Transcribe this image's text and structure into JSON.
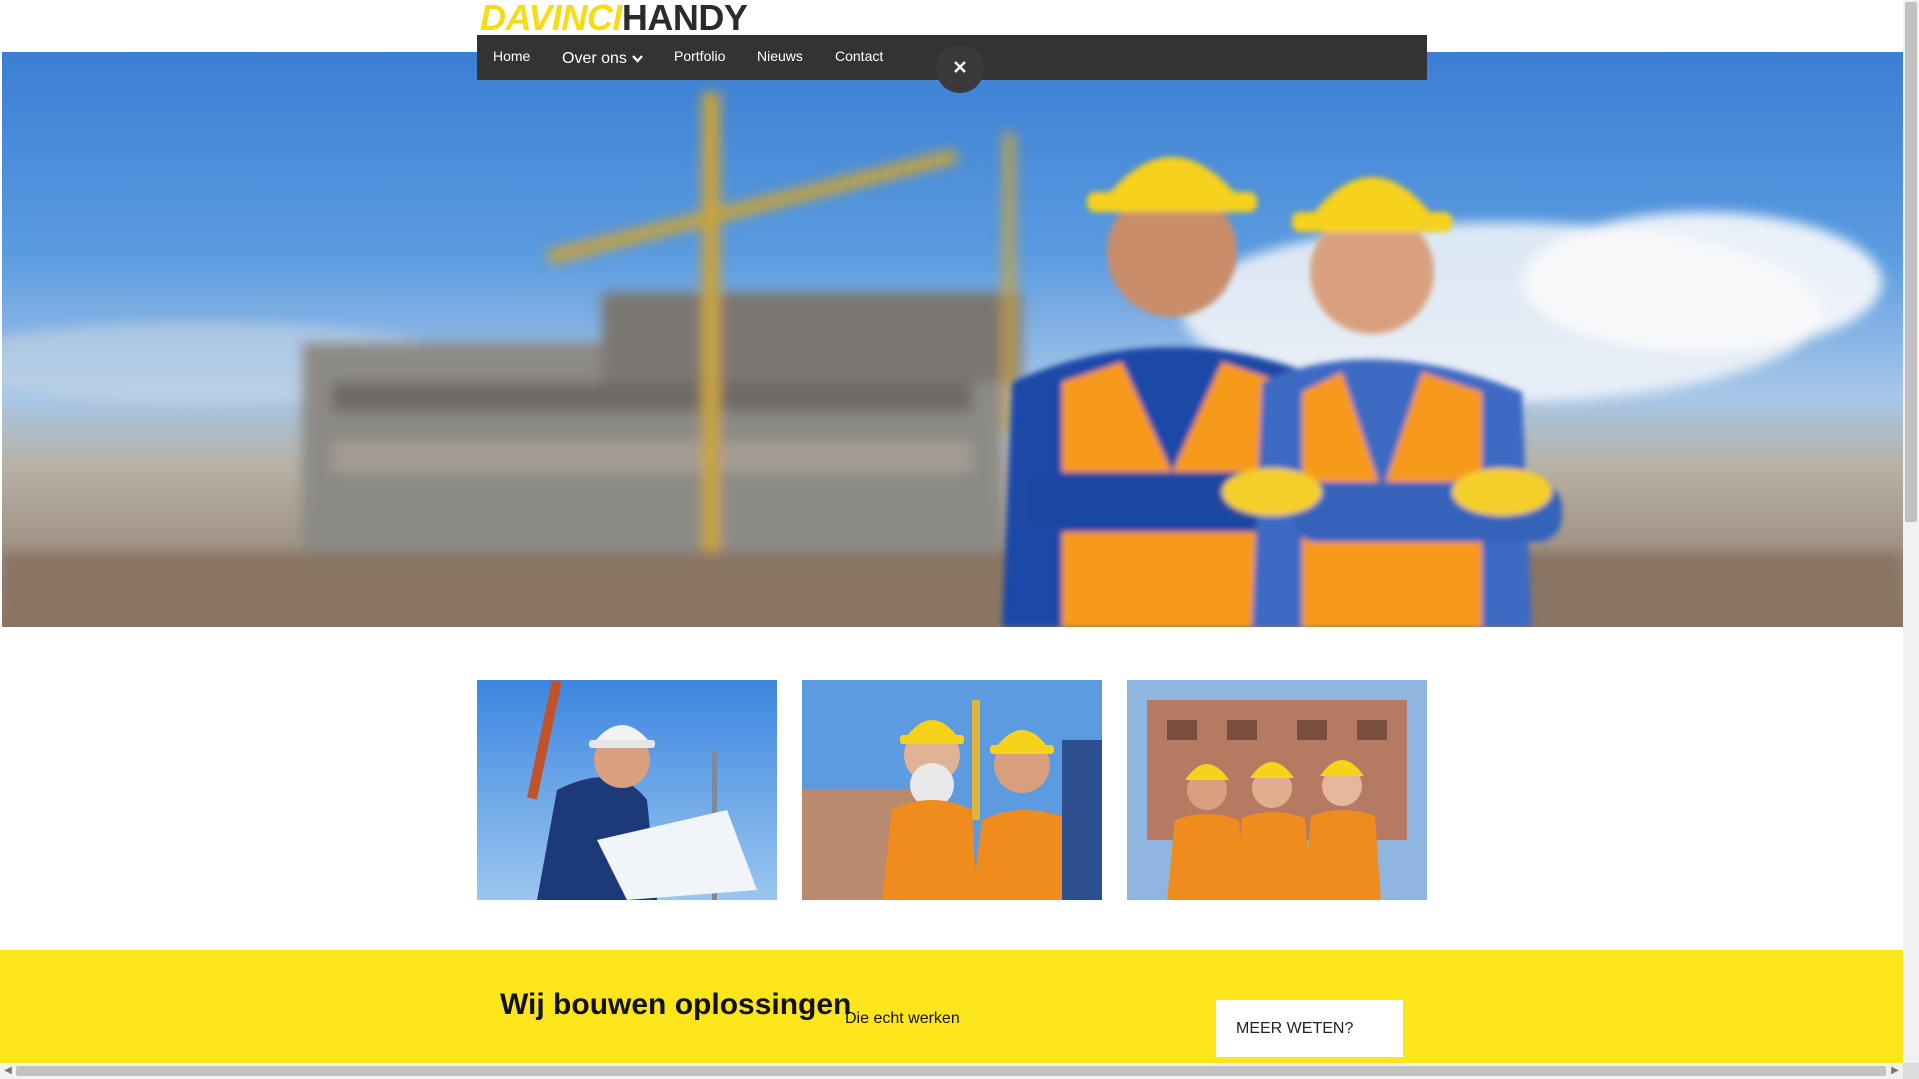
{
  "logo": {
    "part1": "DAVINCI",
    "part2": "HANDY"
  },
  "nav": {
    "items": [
      {
        "label": "Home"
      },
      {
        "label": "Over ons"
      },
      {
        "label": "Portfolio"
      },
      {
        "label": "Nieuws"
      },
      {
        "label": "Contact"
      }
    ]
  },
  "colors": {
    "accent_yellow": "#fde51b",
    "nav_bg": "#333333",
    "logo_dark": "#2b2b2b"
  },
  "icons": {
    "close": "close-icon",
    "dropdown": "chevron-down-icon"
  },
  "band": {
    "title": "Wij bouwen oplossingen",
    "subtitle": "Die echt werken",
    "cta": "MEER WETEN?"
  }
}
